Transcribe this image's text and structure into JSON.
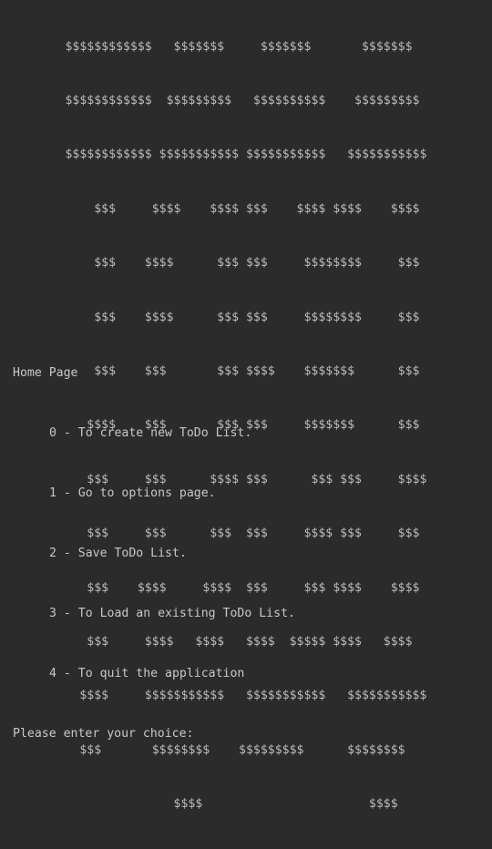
{
  "banner": {
    "lines": [
      "         $$$$$$$$$$$$   $$$$$$$     $$$$$$$       $$$$$$$",
      "         $$$$$$$$$$$$  $$$$$$$$$   $$$$$$$$$$    $$$$$$$$$",
      "         $$$$$$$$$$$$ $$$$$$$$$$$ $$$$$$$$$$$   $$$$$$$$$$$",
      "             $$$     $$$$    $$$$ $$$    $$$$ $$$$    $$$$",
      "             $$$    $$$$      $$$ $$$     $$$$$$$$     $$$",
      "             $$$    $$$$      $$$ $$$     $$$$$$$$     $$$",
      "             $$$    $$$       $$$ $$$$    $$$$$$$      $$$",
      "            $$$$    $$$       $$$ $$$     $$$$$$$      $$$",
      "            $$$     $$$      $$$$ $$$      $$$ $$$     $$$$",
      "            $$$     $$$      $$$  $$$     $$$$ $$$     $$$",
      "            $$$    $$$$     $$$$  $$$     $$$ $$$$    $$$$",
      "            $$$     $$$$   $$$$   $$$$  $$$$$ $$$$   $$$$",
      "           $$$$     $$$$$$$$$$$   $$$$$$$$$$$   $$$$$$$$$$$",
      "           $$$       $$$$$$$$    $$$$$$$$$      $$$$$$$$",
      "                        $$$$                       $$$$"
    ]
  },
  "menu": {
    "title": "Home Page",
    "options": [
      "0 - To create new ToDo List.",
      "1 - Go to options page.",
      "2 - Save ToDo List.",
      "3 - To Load an existing ToDo List.",
      "4 - To quit the application"
    ],
    "prompt": "Please enter your choice:"
  },
  "colors": {
    "background": "#2b2b2b",
    "text": "#c8c8c8"
  }
}
